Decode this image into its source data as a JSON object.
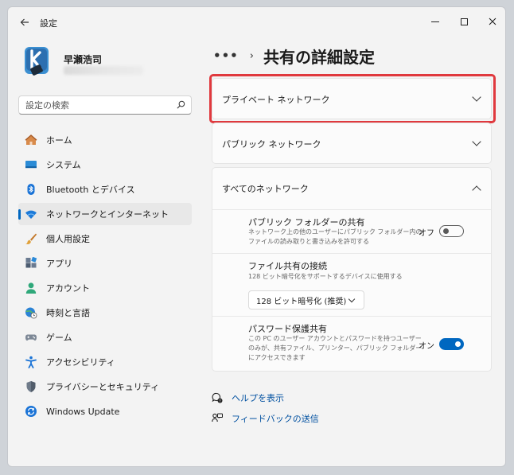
{
  "window": {
    "title": "設定"
  },
  "user": {
    "name": "早瀬浩司"
  },
  "search": {
    "placeholder": "設定の検索"
  },
  "sidebar": {
    "items": [
      {
        "label": "ホーム",
        "icon": "home-icon"
      },
      {
        "label": "システム",
        "icon": "system-icon"
      },
      {
        "label": "Bluetooth とデバイス",
        "icon": "bluetooth-icon"
      },
      {
        "label": "ネットワークとインターネット",
        "icon": "wifi-icon",
        "selected": true
      },
      {
        "label": "個人用設定",
        "icon": "brush-icon"
      },
      {
        "label": "アプリ",
        "icon": "apps-icon"
      },
      {
        "label": "アカウント",
        "icon": "account-icon"
      },
      {
        "label": "時刻と言語",
        "icon": "globe-clock-icon"
      },
      {
        "label": "ゲーム",
        "icon": "gamepad-icon"
      },
      {
        "label": "アクセシビリティ",
        "icon": "accessibility-icon"
      },
      {
        "label": "プライバシーとセキュリティ",
        "icon": "shield-icon"
      },
      {
        "label": "Windows Update",
        "icon": "update-icon"
      }
    ]
  },
  "breadcrumb": {
    "more": "•••",
    "separator": "›",
    "title": "共有の詳細設定"
  },
  "sections": {
    "private": {
      "label": "プライベート ネットワーク"
    },
    "public": {
      "label": "パブリック ネットワーク"
    },
    "all": {
      "label": "すべてのネットワーク",
      "public_folder": {
        "title": "パブリック フォルダーの共有",
        "desc1": "ネットワーク上の他のユーザーにパブリック フォルダー内の",
        "desc2": "ファイルの読み取りと書き込みを許可する",
        "state": "オフ"
      },
      "file_sharing": {
        "title": "ファイル共有の接続",
        "desc": "128 ビット暗号化をサポートするデバイスに使用する",
        "selected": "128 ビット暗号化 (推奨)"
      },
      "password": {
        "title": "パスワード保護共有",
        "desc1": "この PC のユーザー アカウントとパスワードを持つユーザー",
        "desc2": "のみが、共有ファイル、プリンター、パブリック フォルダー",
        "desc3": "にアクセスできます",
        "state": "オン"
      }
    }
  },
  "links": {
    "help": "ヘルプを表示",
    "feedback": "フィードバックの送信"
  },
  "colors": {
    "accent": "#0067c0",
    "highlight": "#e0393e"
  }
}
